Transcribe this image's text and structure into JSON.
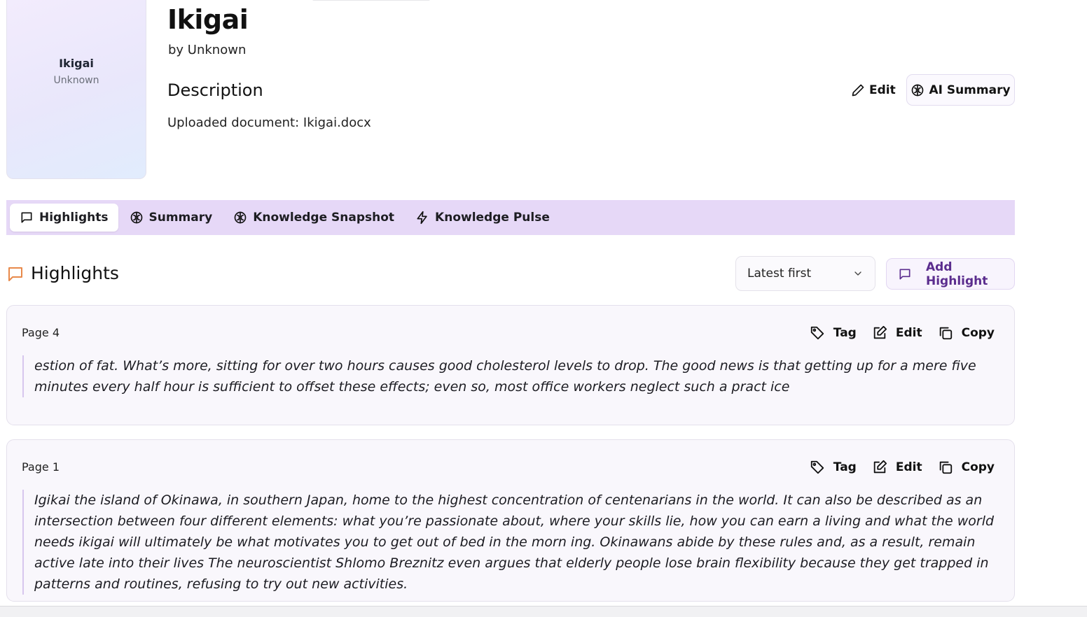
{
  "book": {
    "title": "Ikigai",
    "author_line": "by Unknown",
    "cover_title": "Ikigai",
    "cover_author": "Unknown",
    "description_heading": "Description",
    "description_text": "Uploaded document: Ikigai.docx",
    "edit_label": "Edit",
    "ai_summary_label": "AI Summary"
  },
  "tabs": [
    {
      "label": "Highlights",
      "icon": "message-square-icon",
      "active": true
    },
    {
      "label": "Summary",
      "icon": "brain-icon",
      "active": false
    },
    {
      "label": "Knowledge Snapshot",
      "icon": "brain-icon",
      "active": false
    },
    {
      "label": "Knowledge Pulse",
      "icon": "zap-icon",
      "active": false
    }
  ],
  "highlights_section": {
    "title": "Highlights",
    "sort_value": "Latest first",
    "add_label": "Add Highlight"
  },
  "highlights": [
    {
      "page": "Page 4",
      "text": "estion of fat. What’s more, sitting for over two hours causes good cholesterol levels to drop. The good news is that getting up for a mere five minutes every half hour is sufficient to offset these effects; even so, most office workers neglect such a pract ice",
      "tag_label": "Tag",
      "edit_label": "Edit",
      "copy_label": "Copy"
    },
    {
      "page": "Page 1",
      "text": "Igikai the island of Okinawa, in southern Japan, home to the highest concentration of centenarians in the world. It can also be described as an intersection between four different elements: what you’re passionate about, where your skills lie, how you can earn a living and what the world needs ikigai will ultimately be what motivates you to get out of bed in the morn ing. Okinawans abide by these rules and, as a result, remain active late into their lives The neuroscientist Shlomo Breznitz even argues that elderly people lose brain flexibility because they get trapped in patterns and routines, refusing to try out new activities.",
      "tag_label": "Tag",
      "edit_label": "Edit",
      "copy_label": "Copy"
    }
  ],
  "colors": {
    "accent_purple": "#5b2d8e",
    "tab_bar_bg": "#e6d8f7",
    "section_icon": "#e8894a"
  }
}
